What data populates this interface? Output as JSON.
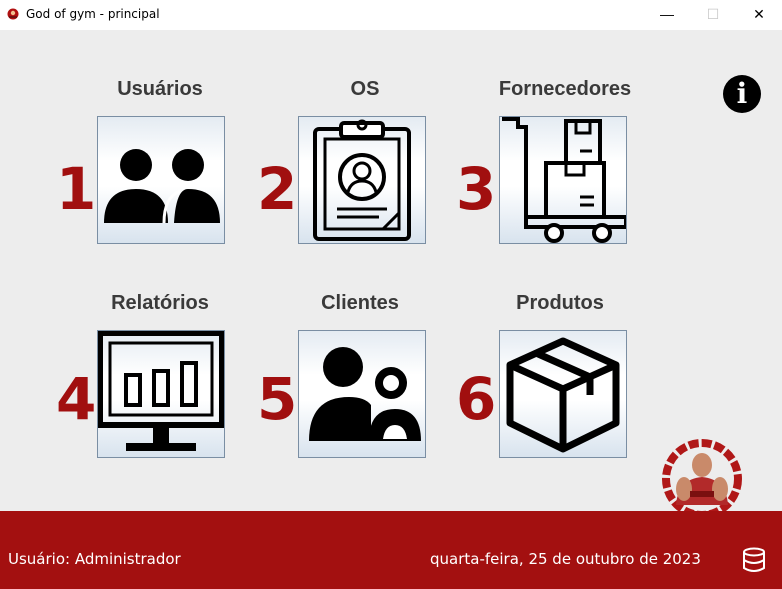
{
  "window": {
    "title": "God of gym - principal",
    "minimize": "—",
    "maximize": "☐",
    "close": "✕"
  },
  "modules": [
    {
      "label": "Usuários",
      "number": "1",
      "icon": "users-icon"
    },
    {
      "label": "OS",
      "number": "2",
      "icon": "clipboard-profile-icon"
    },
    {
      "label": "Fornecedores",
      "number": "3",
      "icon": "hand-truck-boxes-icon"
    },
    {
      "label": "Relatórios",
      "number": "4",
      "icon": "monitor-chart-icon"
    },
    {
      "label": "Clientes",
      "number": "5",
      "icon": "clients-icon"
    },
    {
      "label": "Produtos",
      "number": "6",
      "icon": "package-box-icon"
    }
  ],
  "info_button": "i",
  "status": {
    "user": "Usuário: Administrador",
    "date": "quarta-feira, 25 de outubro de 2023"
  },
  "colors": {
    "accent": "#a31010",
    "number": "#a10f0f",
    "background": "#ededed"
  }
}
